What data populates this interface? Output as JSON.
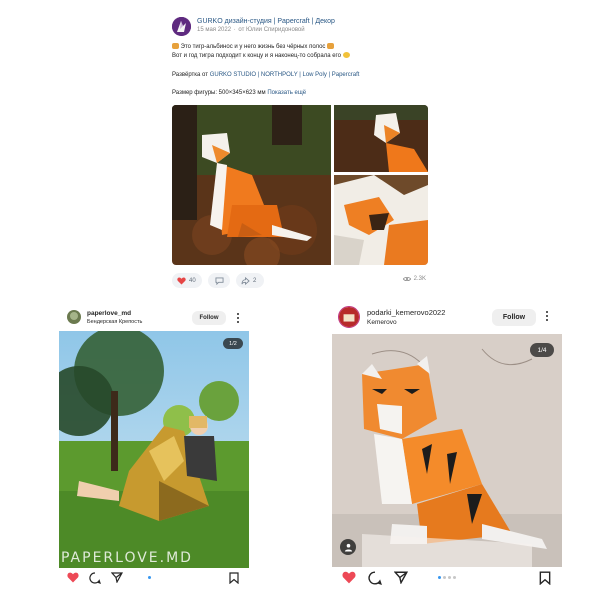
{
  "vk_post": {
    "author": "GURKO дизайн-студия | Papercraft | Декор",
    "date": "15 мая 2022",
    "date_sep": "·",
    "date_suffix": "от Юлии Спиридоновой",
    "line1": "Это тигр-альбинос и у него жизнь без чёрных полос",
    "line2": "Вот и год тигра подходит к концу и я наконец-то собрала его",
    "scan_prefix": "Развёртка от",
    "scan_link": "GURKO STUDIO | NORTHPOLY | Low Poly | Papercraft",
    "size_text": "Размер фигуры: 500×345×623 мм",
    "show_more": "Показать ещё",
    "likes": "40",
    "reposts": "2",
    "views": "2.3K",
    "colors": {
      "link": "#2a5885",
      "like_red": "#e64646"
    }
  },
  "ig_left": {
    "username": "paperlove_md",
    "location": "Бендерская Крепость",
    "follow": "Follow",
    "counter": "1/2",
    "watermark": "PAPERLOVE.MD",
    "icons": [
      "heart-icon",
      "comment-icon",
      "share-icon",
      "bookmark-icon"
    ]
  },
  "ig_right": {
    "username": "podarki_kemerovo2022",
    "location": "Kemerovo",
    "follow": "Follow",
    "counter": "1/4",
    "icons": [
      "heart-icon",
      "comment-icon",
      "share-icon",
      "bookmark-icon"
    ]
  },
  "colors": {
    "ig_like": "#ed4956",
    "ig_dot_active": "#3897f0"
  }
}
